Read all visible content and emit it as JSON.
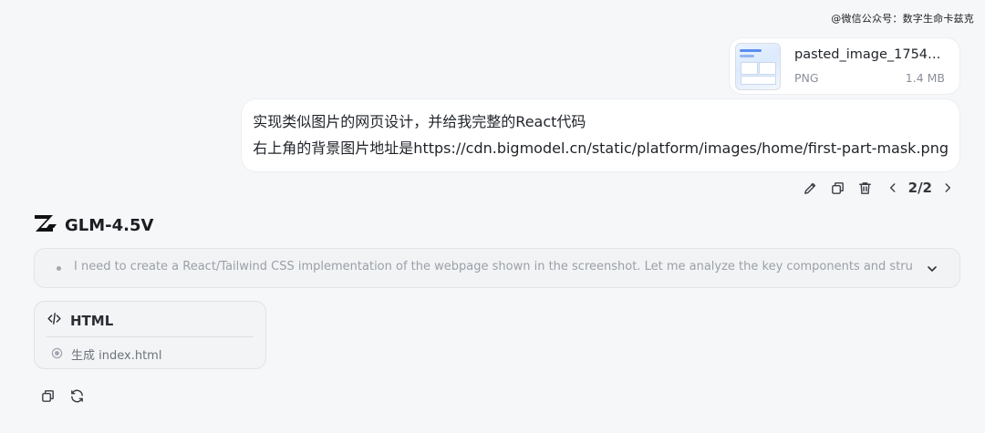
{
  "watermark": "@微信公众号：数字生命卡兹克",
  "attachment": {
    "file_name": "pasted_image_17548...",
    "file_type": "PNG",
    "file_size": "1.4 MB"
  },
  "user_message": {
    "lines": [
      "实现类似图片的网页设计，并给我完整的React代码",
      "右上角的背景图片地址是https://cdn.bigmodel.cn/static/platform/images/home/first-part-mask.png"
    ]
  },
  "message_actions": {
    "pager": "2/2",
    "icons": [
      "edit-icon",
      "copy-icon",
      "trash-icon",
      "chevron-left-icon",
      "chevron-right-icon"
    ]
  },
  "assistant": {
    "model_name": "GLM-4.5V",
    "thinking_text": "I need to create a React/Tailwind CSS implementation of the webpage shown in the screenshot. Let me analyze the key components and structure:...",
    "artifact": {
      "title": "HTML",
      "step_label": "生成 index.html"
    },
    "reply_icons": [
      "copy-icon",
      "refresh-icon"
    ]
  },
  "colors": {
    "background": "#f6f7f9",
    "bubble": "#ffffff",
    "muted_text": "#9aa0a8",
    "accent": "#5b8def"
  }
}
